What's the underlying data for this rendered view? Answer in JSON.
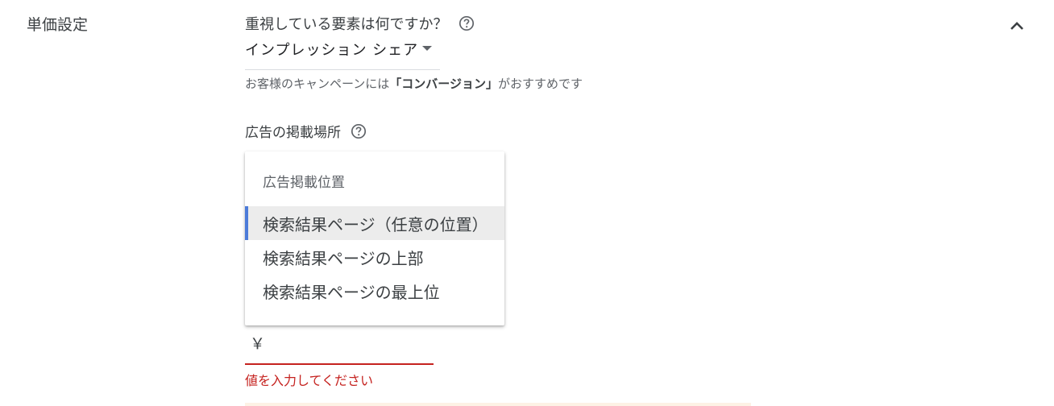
{
  "section": {
    "title": "単価設定"
  },
  "focus": {
    "question": "重視している要素は何ですか？",
    "selected_value": "インプレッション シェア",
    "hint_prefix": "お客様のキャンペーンには",
    "hint_emphasis": "「コンバージョン」",
    "hint_suffix": "がおすすめです"
  },
  "placement": {
    "question": "広告の掲載場所",
    "dropdown": {
      "header": "広告掲載位置",
      "options": [
        {
          "label": "検索結果ページ（任意の位置）",
          "selected": true
        },
        {
          "label": "検索結果ページの上部",
          "selected": false
        },
        {
          "label": "検索結果ページの最上位",
          "selected": false
        }
      ]
    }
  },
  "price": {
    "currency": "￥",
    "value": "",
    "error": "値を入力してください"
  },
  "icons": {
    "help": "help-circle-icon",
    "collapse": "chevron-up-icon",
    "dropdown_arrow": "arrow-drop-down-icon"
  },
  "colors": {
    "accent": "#4c7bd9",
    "error": "#c5221f",
    "selected_bg": "#ececec"
  }
}
